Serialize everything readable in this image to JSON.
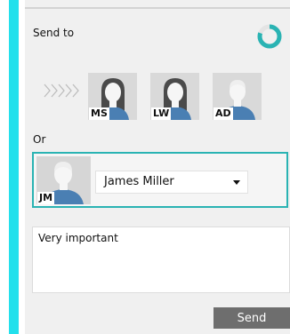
{
  "send_section": {
    "label": "Send to",
    "recipients": [
      {
        "initials": "MS",
        "avatar": "female-avatar"
      },
      {
        "initials": "LW",
        "avatar": "female-avatar"
      },
      {
        "initials": "AD",
        "avatar": "male-avatar"
      }
    ]
  },
  "or_label": "Or",
  "selector": {
    "initials": "JM",
    "avatar": "male-avatar",
    "selected_value": "James Miller"
  },
  "message": {
    "value": "Very important"
  },
  "send_button": {
    "label": "Send"
  },
  "progress": {
    "fraction": 0.8
  },
  "colors": {
    "accent": "#22e0ec",
    "teal": "#2ab3b3",
    "button_bg": "#6e6e6e"
  },
  "icons": [
    "progress-ring-icon",
    "chevrons-right-icon",
    "female-avatar",
    "male-avatar",
    "dropdown-arrow-icon"
  ]
}
